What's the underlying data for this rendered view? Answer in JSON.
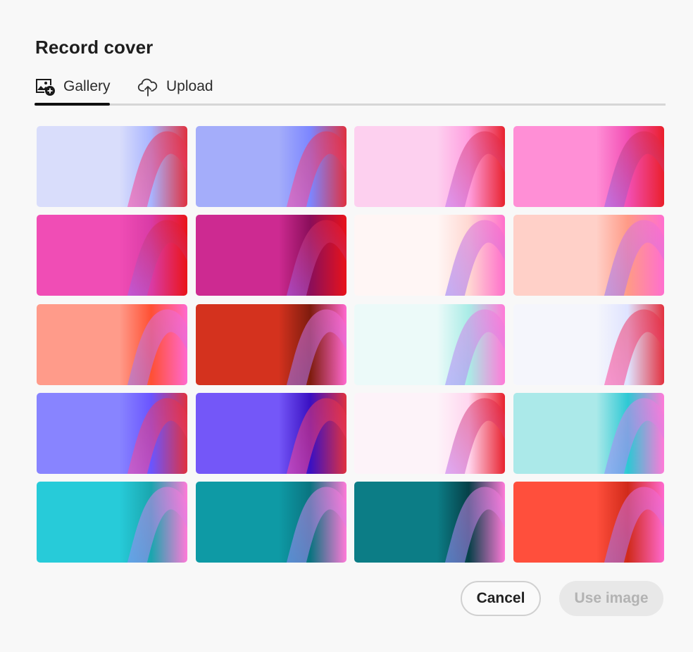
{
  "dialog": {
    "title": "Record cover"
  },
  "tabs": [
    {
      "label": "Gallery",
      "icon": "image-add-icon",
      "selected": true
    },
    {
      "label": "Upload",
      "icon": "cloud-upload-icon",
      "selected": false
    }
  ],
  "gallery": {
    "thumbnails": [
      {
        "base": "#d9ddfb",
        "mid": "#a8b4ff",
        "edge": "#e0313f",
        "accent": "#ff4fb0"
      },
      {
        "base": "#a4adfa",
        "mid": "#7c86ff",
        "edge": "#e0313f",
        "accent": "#ff4fb0"
      },
      {
        "base": "#fdd0ef",
        "mid": "#ff9fe0",
        "edge": "#e8222e",
        "accent": "#c07cff"
      },
      {
        "base": "#ff8fd6",
        "mid": "#f24fb4",
        "edge": "#ea1f2b",
        "accent": "#8f70ff"
      },
      {
        "base": "#f04db5",
        "mid": "#d93ba6",
        "edge": "#ea1418",
        "accent": "#9d6cff"
      },
      {
        "base": "#cd2a91",
        "mid": "#8a0e5a",
        "edge": "#e8121a",
        "accent": "#9a6cff"
      },
      {
        "base": "#fff6f5",
        "mid": "#ffd8d2",
        "edge": "#ff6fcb",
        "accent": "#8a7cff"
      },
      {
        "base": "#ffd0c8",
        "mid": "#ff9a86",
        "edge": "#ff6fcf",
        "accent": "#8a7cff"
      },
      {
        "base": "#ff9b8a",
        "mid": "#ff5033",
        "edge": "#ff69cf",
        "accent": "#8a7cff"
      },
      {
        "base": "#d4321e",
        "mid": "#7e1c0e",
        "edge": "#ff69cf",
        "accent": "#8a7cff"
      },
      {
        "base": "#ecfaf9",
        "mid": "#a9ece6",
        "edge": "#ff7ad8",
        "accent": "#9a90ff"
      },
      {
        "base": "#f5f6fc",
        "mid": "#dfe3ff",
        "edge": "#e2313f",
        "accent": "#ff4fb0"
      },
      {
        "base": "#8884ff",
        "mid": "#6a55ff",
        "edge": "#e0313f",
        "accent": "#ff4fb0"
      },
      {
        "base": "#7457f8",
        "mid": "#3a10c2",
        "edge": "#e0313f",
        "accent": "#ff4fb0"
      },
      {
        "base": "#fdf3f9",
        "mid": "#ffd6ef",
        "edge": "#e8222e",
        "accent": "#c07cff"
      },
      {
        "base": "#abe9e9",
        "mid": "#2dc8d4",
        "edge": "#ff7ad8",
        "accent": "#8a90ff"
      },
      {
        "base": "#27cbd9",
        "mid": "#1aa6ae",
        "edge": "#ff7ad8",
        "accent": "#8a90ff"
      },
      {
        "base": "#0e9aa5",
        "mid": "#0a7480",
        "edge": "#ff7ad8",
        "accent": "#8a90ff"
      },
      {
        "base": "#0c7d86",
        "mid": "#064048",
        "edge": "#ff7ad8",
        "accent": "#8a90ff"
      },
      {
        "base": "#ff4f3c",
        "mid": "#d02a1a",
        "edge": "#ff69cf",
        "accent": "#8a7cff"
      }
    ]
  },
  "footer": {
    "cancel_label": "Cancel",
    "use_label": "Use image"
  }
}
